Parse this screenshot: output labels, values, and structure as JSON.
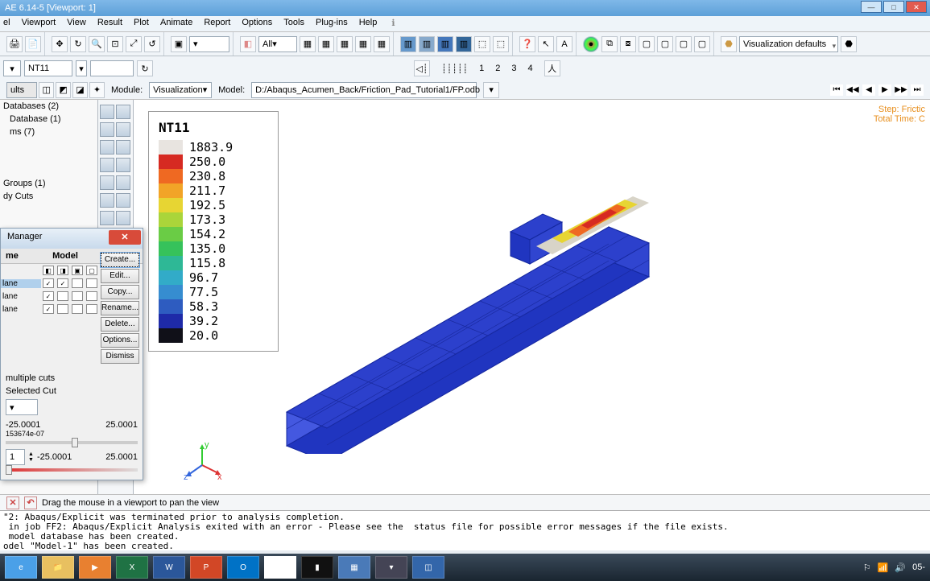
{
  "window": {
    "title": "AE 6.14-5   [Viewport: 1]"
  },
  "menu": [
    "el",
    "Viewport",
    "View",
    "Result",
    "Plot",
    "Animate",
    "Report",
    "Options",
    "Tools",
    "Plug-ins",
    "Help"
  ],
  "toolbar": {
    "displaygroup_label": "All",
    "field_dropdown": "NT11",
    "vizdefault": "Visualization defaults"
  },
  "context": {
    "module_label": "Module:",
    "module_value": "Visualization",
    "model_label": "Model:",
    "model_value": "D:/Abaqus_Acumen_Back/Friction_Pad_Tutorial1/FP.odb"
  },
  "ruler": [
    "1",
    "2",
    "3",
    "4"
  ],
  "tree": {
    "tab": "ults",
    "items": [
      "Databases (2)",
      "Database (1)",
      "ms (7)",
      "",
      "Groups (1)",
      "dy Cuts"
    ]
  },
  "legend": {
    "title": "NT11",
    "entries": [
      {
        "c": "#e8e4e0",
        "v": "1883.9"
      },
      {
        "c": "#d62a22",
        "v": "250.0"
      },
      {
        "c": "#ef6922",
        "v": "230.8"
      },
      {
        "c": "#f2a427",
        "v": "211.7"
      },
      {
        "c": "#e7d533",
        "v": "192.5"
      },
      {
        "c": "#aad53a",
        "v": "173.3"
      },
      {
        "c": "#6acc45",
        "v": "154.2"
      },
      {
        "c": "#36c25b",
        "v": "135.0"
      },
      {
        "c": "#2eb896",
        "v": "115.8"
      },
      {
        "c": "#32abc8",
        "v": "96.7"
      },
      {
        "c": "#368dd0",
        "v": "77.5"
      },
      {
        "c": "#2e5cc0",
        "v": "58.3"
      },
      {
        "c": "#1e2aa8",
        "v": "39.2"
      },
      {
        "c": "#101018",
        "v": "20.0"
      }
    ]
  },
  "stepinfo": {
    "l1": "Step: Frictic",
    "l2": "Total Time: C"
  },
  "dialog": {
    "title": "Manager",
    "col_name": "me",
    "col_model": "Model",
    "rows": [
      {
        "name": "lane",
        "sel": true,
        "c1": true,
        "c2": true
      },
      {
        "name": "lane",
        "sel": false,
        "c1": true,
        "c2": false
      },
      {
        "name": "lane",
        "sel": false,
        "c1": true,
        "c2": false
      }
    ],
    "btns": [
      "Create...",
      "Edit...",
      "Copy...",
      "Rename...",
      "Delete...",
      "Options...",
      "Dismiss"
    ],
    "multcuts": "multiple cuts",
    "selcut": "Selected Cut",
    "vmin": "-25.0001",
    "vmax": "25.0001",
    "vcur": "153674e-07",
    "step": "1",
    "svmin": "-25.0001",
    "svmax": "25.0001"
  },
  "status": {
    "prompt": "Drag the mouse in a viewport to pan the view"
  },
  "messages": "\"2: Abaqus/Explicit was terminated prior to analysis completion.\n in job FF2: Abaqus/Explicit Analysis exited with an error - Please see the  status file for possible error messages if the file exists.\n model database has been created.\nodel \"Model-1\" has been created.",
  "tray": {
    "time": "05-"
  }
}
